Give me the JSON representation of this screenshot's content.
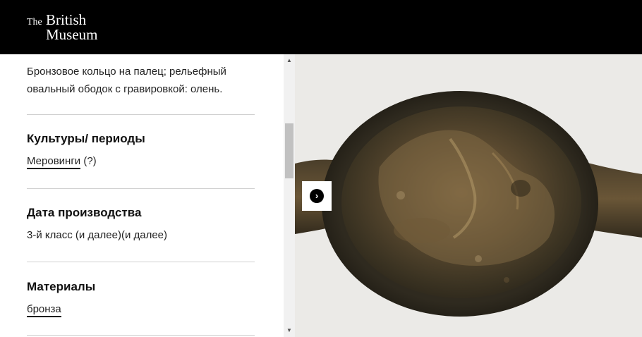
{
  "header": {
    "logo_the": "The",
    "logo_british": "British",
    "logo_museum": "Museum"
  },
  "details": {
    "description": "Бронзовое кольцо на палец; рельефный овальный ободок с гравировкой: олень.",
    "cultures": {
      "heading": "Культуры/ периоды",
      "link": "Меровинги",
      "suffix": " (?)"
    },
    "date": {
      "heading": "Дата производства",
      "value": "3-й класс (и далее)(и далее)"
    },
    "materials": {
      "heading": "Материалы",
      "link": "бронза"
    }
  },
  "image": {
    "next_icon": "chevron-right-icon",
    "next_glyph": "›"
  },
  "scrollbar": {
    "up_glyph": "▲",
    "down_glyph": "▼"
  }
}
